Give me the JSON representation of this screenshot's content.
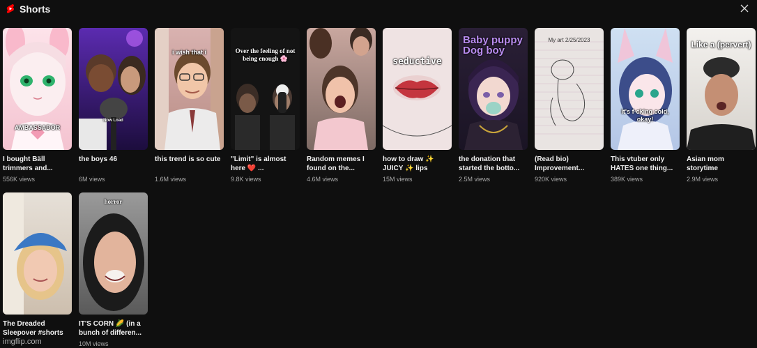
{
  "header": {
    "title": "Shorts",
    "logo_icon": "youtube-shorts-icon",
    "close_icon": "close-icon"
  },
  "colors": {
    "background": "#0f0f0f",
    "accent": "#ff0000",
    "text": "#f1f1f1",
    "secondary_text": "#aaaaaa"
  },
  "shorts": [
    {
      "title": "I bought Bäll trimmers and...",
      "views": "556K views",
      "overlay": "AMBASSADOR"
    },
    {
      "title": "the boys 46",
      "views": "6M views",
      "overlay": "Now Load"
    },
    {
      "title": "this trend is so cute",
      "views": "1.6M views",
      "overlay": "i wish that i"
    },
    {
      "title": "\"Limit\" is almost here ❤️ ...",
      "views": "9.8K views",
      "overlay": "Over the feeling of not being enough 🌸"
    },
    {
      "title": "Random memes I found on the...",
      "views": "4.6M views",
      "overlay": ""
    },
    {
      "title": "how to draw ✨ JUICY ✨ lips",
      "views": "15M views",
      "overlay": "seductive"
    },
    {
      "title": "the donation that started the botto...",
      "views": "2.5M views",
      "overlay": "Baby puppy Dog boy"
    },
    {
      "title": "(Read bio) Improvement...",
      "views": "920K views",
      "overlay": "My art 2/25/2023"
    },
    {
      "title": "This vtuber only HATES one thing...",
      "views": "389K views",
      "overlay": "it's f-cking cold, okay!"
    },
    {
      "title": "Asian mom storytime",
      "views": "2.9M views",
      "overlay": "Like a (pervert)"
    },
    {
      "title": "The Dreaded Sleepover #shorts",
      "views": "",
      "overlay": ""
    },
    {
      "title": "IT'S CORN 🌽 (in a bunch of differen...",
      "views": "10M views",
      "overlay": "horror"
    }
  ],
  "watermark": "imgflip.com"
}
